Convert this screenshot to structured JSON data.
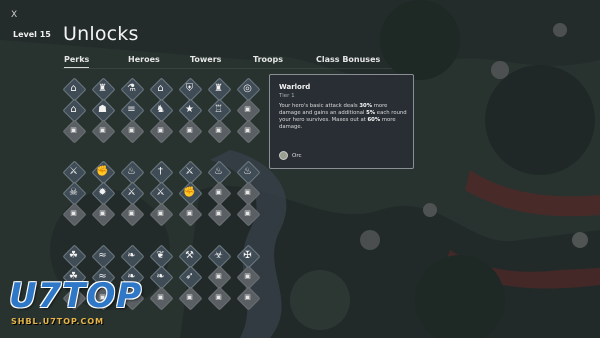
{
  "header": {
    "close_label": "X",
    "level_label": "Level 15",
    "title": "Unlocks"
  },
  "tabs": [
    {
      "label": "Perks",
      "active": true
    },
    {
      "label": "Heroes",
      "active": false
    },
    {
      "label": "Towers",
      "active": false
    },
    {
      "label": "Troops",
      "active": false
    },
    {
      "label": "Class Bonuses",
      "active": false
    }
  ],
  "perk_groups": [
    {
      "rows": [
        [
          "house-icon",
          "tower-icon",
          "potion-icon",
          "barracks-icon",
          "shield-icon",
          "castle-icon",
          "target-icon"
        ],
        [
          "house-upgrade-icon",
          "village-icon",
          "wall-icon",
          "knight-icon",
          "star-icon",
          "fortress-icon",
          "locked"
        ],
        [
          "locked",
          "locked",
          "locked",
          "locked",
          "locked",
          "locked",
          "locked"
        ]
      ]
    },
    {
      "rows": [
        [
          "warlord-icon",
          "fist-icon",
          "flame-icon",
          "sword-icon",
          "warrior-icon",
          "fire-icon",
          "fire-icon"
        ],
        [
          "orc-icon",
          "rage-icon",
          "crossed-swords-icon",
          "crossed-swords-icon",
          "punch-icon",
          "locked",
          "locked"
        ],
        [
          "locked",
          "locked",
          "locked",
          "locked",
          "locked",
          "locked",
          "locked"
        ]
      ]
    },
    {
      "rows": [
        [
          "leaf-icon",
          "wind-icon",
          "wing-icon",
          "laurel-icon",
          "axe-icon",
          "biohazard-icon",
          "cross-icon"
        ],
        [
          "nature-icon",
          "wind-icon",
          "wing-icon",
          "bird-icon",
          "bow-icon",
          "locked",
          "locked"
        ],
        [
          "locked",
          "locked",
          "locked",
          "locked",
          "locked",
          "locked",
          "locked"
        ]
      ]
    }
  ],
  "tooltip": {
    "name": "Warlord",
    "tier": "Tier 1",
    "desc_1": "Your hero's basic attack deals ",
    "desc_b1": "30%",
    "desc_2": " more damage and gains an additional ",
    "desc_b2": "5%",
    "desc_3": " each round your hero survives. Maxes out at ",
    "desc_b3": "60%",
    "desc_4": " more damage.",
    "race": "Orc"
  },
  "watermark": {
    "main": "U7TOP",
    "sub": "SHBL.U7TOP.COM"
  },
  "colors": {
    "background": "#2d3a36",
    "unlocked_tile": "#3f4b55",
    "locked_tile": "#5a5f63",
    "watermark_blue": "#2f78c8",
    "watermark_gold": "#e8b64a"
  }
}
